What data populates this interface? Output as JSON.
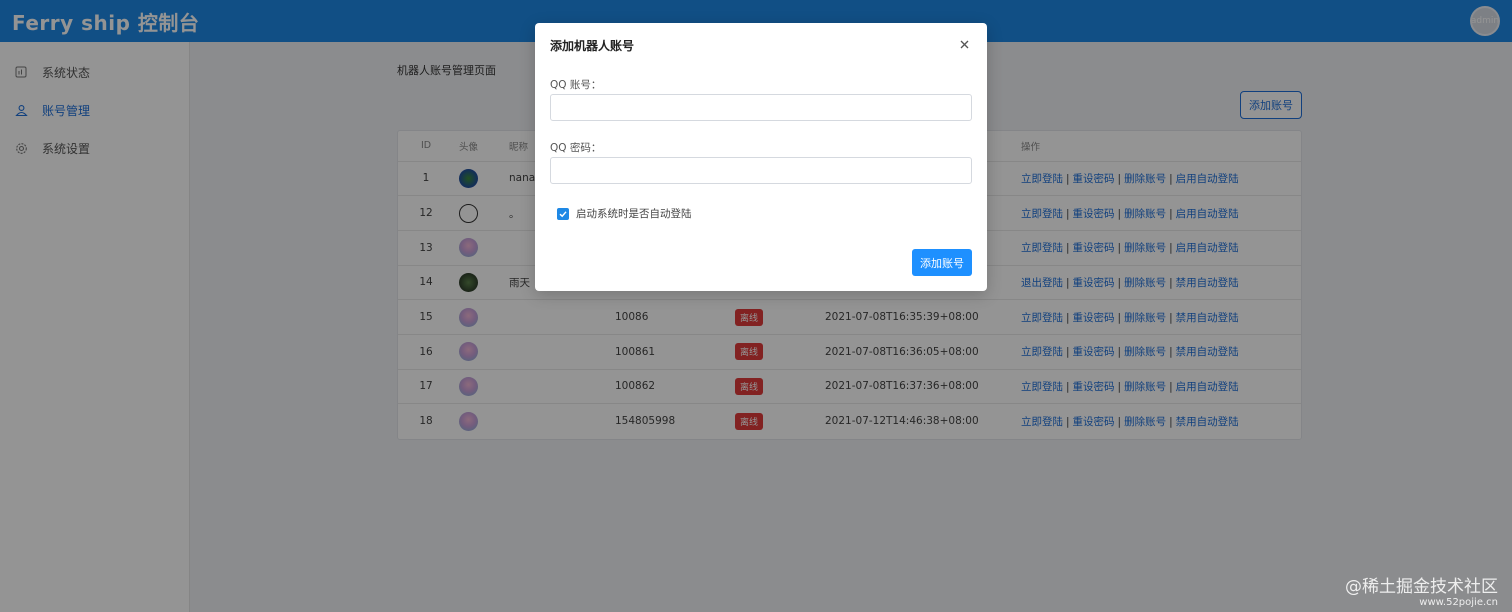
{
  "header": {
    "brand": "Ferry ship 控制台",
    "avatar_text": "admin"
  },
  "sidebar": {
    "items": [
      {
        "label": "系统状态",
        "icon": "dashboard-icon",
        "active": false
      },
      {
        "label": "账号管理",
        "icon": "users-icon",
        "active": true
      },
      {
        "label": "系统设置",
        "icon": "gear-icon",
        "active": false
      }
    ]
  },
  "main": {
    "page_title": "机器人账号管理页面",
    "add_button": "添加账号",
    "table": {
      "headers": [
        "ID",
        "头像",
        "昵称",
        "",
        "",
        "",
        "操作"
      ],
      "rows": [
        {
          "id": "1",
          "avatar": "av-green",
          "nick": "nana",
          "qq": "",
          "status": "",
          "time": "",
          "ops": [
            "立即登陆",
            "重设密码",
            "删除账号",
            "启用自动登陆"
          ]
        },
        {
          "id": "12",
          "avatar": "av-line",
          "nick": "。",
          "qq": "",
          "status": "",
          "time": "",
          "ops": [
            "立即登陆",
            "重设密码",
            "删除账号",
            "启用自动登陆"
          ]
        },
        {
          "id": "13",
          "avatar": "av-pink",
          "nick": "",
          "qq": "",
          "status": "",
          "time": "",
          "ops": [
            "立即登陆",
            "重设密码",
            "删除账号",
            "启用自动登陆"
          ]
        },
        {
          "id": "14",
          "avatar": "av-dark",
          "nick": "雨天",
          "qq": "",
          "status": "",
          "time": "",
          "ops": [
            "退出登陆",
            "重设密码",
            "删除账号",
            "禁用自动登陆"
          ]
        },
        {
          "id": "15",
          "avatar": "av-pink",
          "nick": "",
          "qq": "10086",
          "status": "离线",
          "time": "2021-07-08T16:35:39+08:00",
          "ops": [
            "立即登陆",
            "重设密码",
            "删除账号",
            "禁用自动登陆"
          ]
        },
        {
          "id": "16",
          "avatar": "av-pink",
          "nick": "",
          "qq": "100861",
          "status": "离线",
          "time": "2021-07-08T16:36:05+08:00",
          "ops": [
            "立即登陆",
            "重设密码",
            "删除账号",
            "禁用自动登陆"
          ]
        },
        {
          "id": "17",
          "avatar": "av-pink",
          "nick": "",
          "qq": "100862",
          "status": "离线",
          "time": "2021-07-08T16:37:36+08:00",
          "ops": [
            "立即登陆",
            "重设密码",
            "删除账号",
            "启用自动登陆"
          ]
        },
        {
          "id": "18",
          "avatar": "av-pink",
          "nick": "",
          "qq": "154805998",
          "status": "离线",
          "time": "2021-07-12T14:46:38+08:00",
          "ops": [
            "立即登陆",
            "重设密码",
            "删除账号",
            "禁用自动登陆"
          ]
        }
      ]
    }
  },
  "modal": {
    "title": "添加机器人账号",
    "close_icon": "close-icon",
    "qq_label": "QQ 账号：",
    "qq_value": "",
    "password_label": "QQ 密码：",
    "password_value": "",
    "auto_login_label": "启动系统时是否自动登陆",
    "auto_login_checked": true,
    "submit": "添加账号"
  },
  "watermark": {
    "line1": "@稀土掘金技术社区",
    "line2": "www.52pojie.cn"
  },
  "colors": {
    "header": "#1e88e5",
    "accent": "#1e6fd9",
    "offline": "#e03c3c",
    "online": "#2dbb55"
  }
}
